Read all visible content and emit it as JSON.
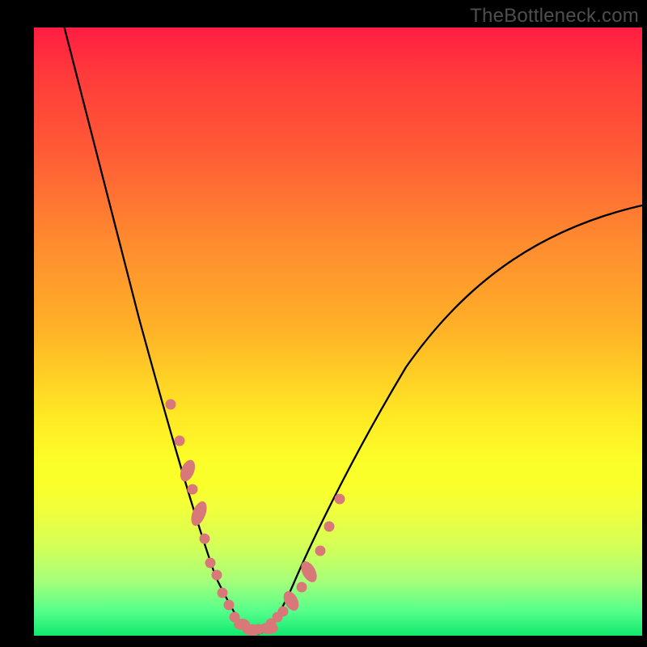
{
  "watermark": "TheBottleneck.com",
  "colors": {
    "frame_bg": "#000000",
    "curve_stroke": "#000000",
    "marker_fill": "#d97878",
    "gradient_stops": [
      "#ff1d42",
      "#ff3b3b",
      "#ff5a36",
      "#ff8a2f",
      "#ffb327",
      "#ffe924",
      "#fbff29",
      "#f1ff3b",
      "#d6ff55",
      "#a6ff7a",
      "#54ff8b",
      "#11e86e"
    ]
  },
  "chart_data": {
    "type": "line",
    "title": "",
    "xlabel": "",
    "ylabel": "",
    "xlim": [
      0,
      100
    ],
    "ylim": [
      0,
      100
    ],
    "grid": false,
    "series": [
      {
        "name": "bottleneck-curve",
        "x": [
          5,
          10,
          15,
          20,
          23,
          26,
          28,
          30,
          32,
          34,
          36,
          38,
          40,
          43,
          46,
          50,
          55,
          60,
          65,
          70,
          75,
          80,
          85,
          90,
          95,
          100
        ],
        "y": [
          100,
          84,
          66,
          48,
          36,
          24,
          16,
          10,
          5,
          2,
          1,
          0,
          1,
          2,
          5,
          10,
          17,
          24,
          31,
          38,
          44,
          50,
          55,
          60,
          64,
          68
        ]
      }
    ],
    "markers": {
      "name": "sample-points",
      "x": [
        22.5,
        24,
        25,
        26,
        27,
        28,
        29,
        30,
        31,
        32,
        33,
        34,
        35,
        36,
        37,
        38,
        39,
        40,
        41,
        42.5,
        44,
        45.5,
        47,
        48.5
      ],
      "y": [
        38,
        32,
        28,
        24,
        20,
        16,
        12,
        10,
        7,
        5,
        3,
        2,
        1,
        0,
        1,
        1,
        2,
        3,
        4,
        6,
        8,
        11,
        14,
        18
      ]
    }
  }
}
